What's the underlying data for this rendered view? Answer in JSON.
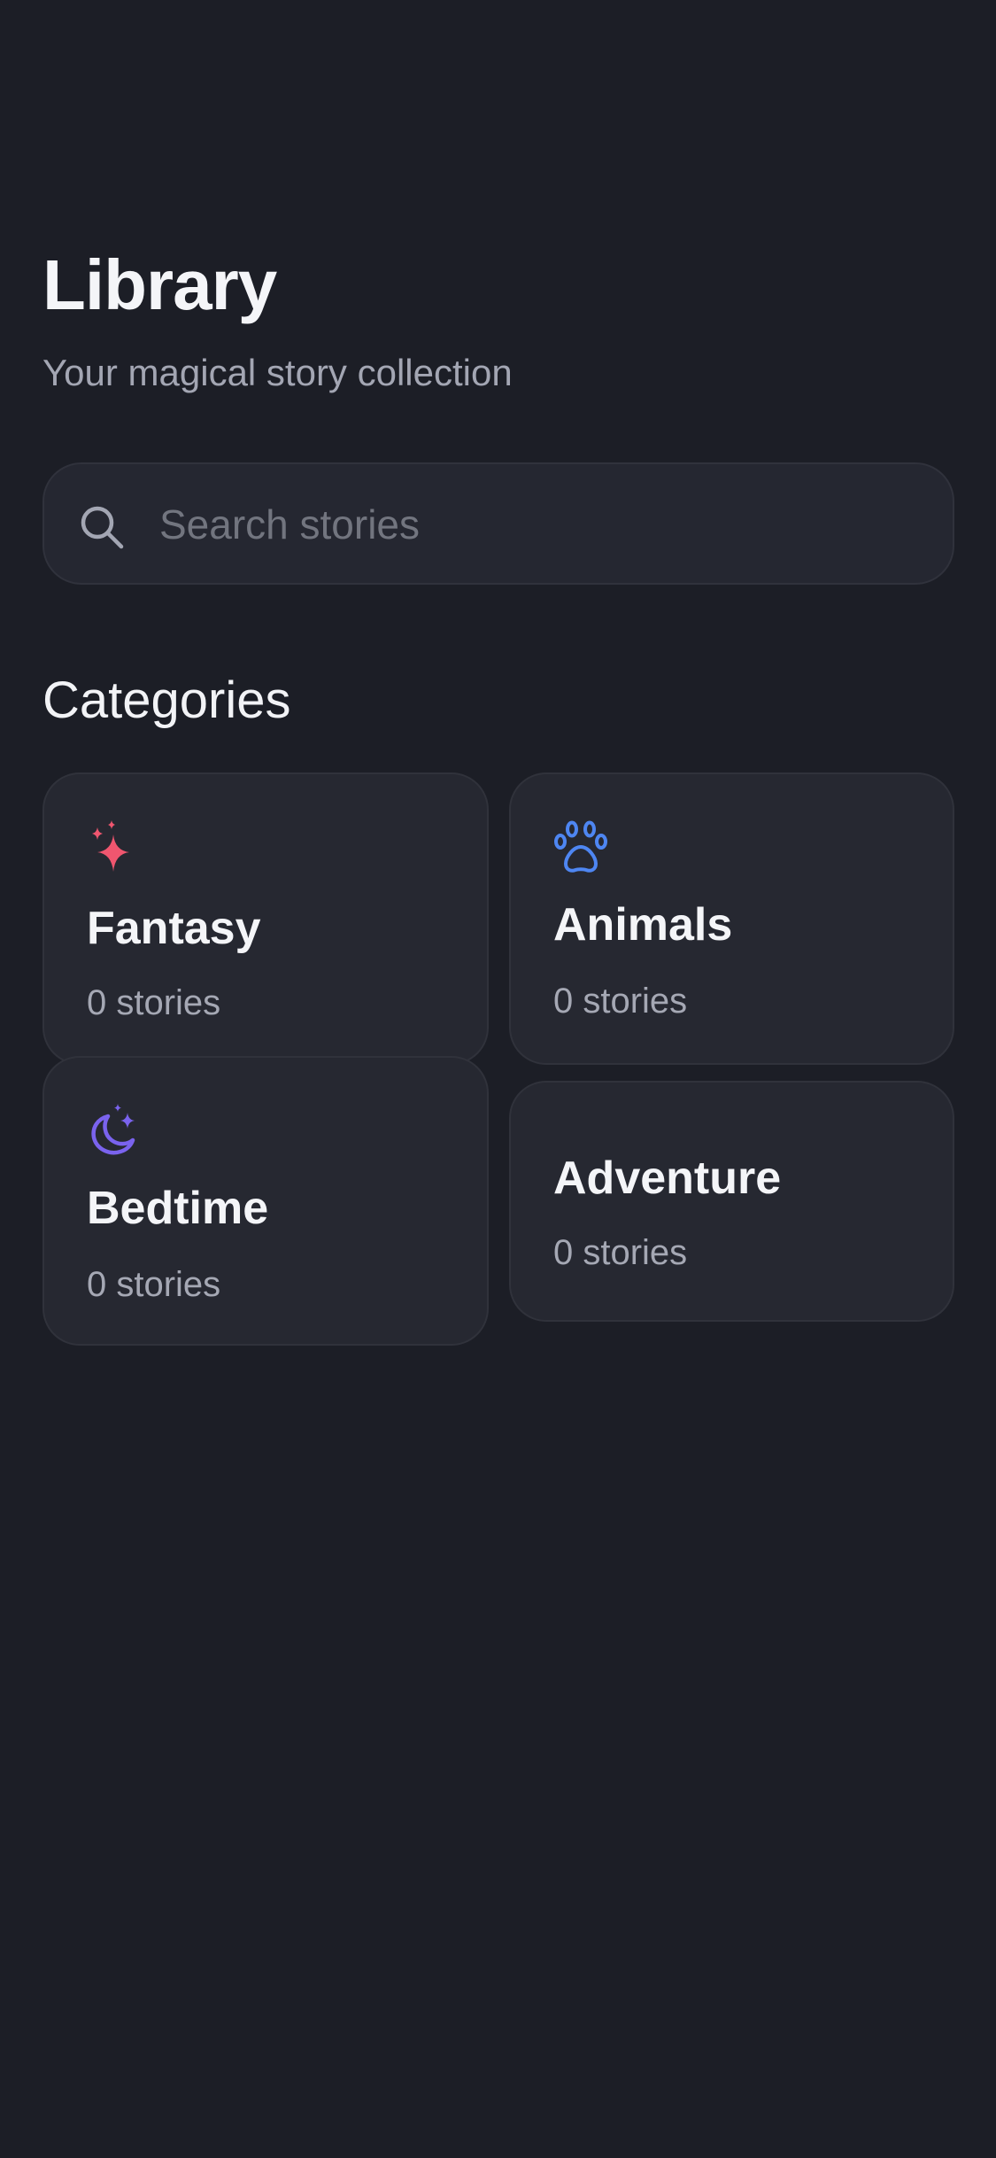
{
  "header": {
    "title": "Library",
    "subtitle": "Your magical story collection"
  },
  "search": {
    "placeholder": "Search stories",
    "value": "",
    "icon": "search-icon"
  },
  "categories": {
    "title": "Categories",
    "items": [
      {
        "name": "Fantasy",
        "count": "0 stories",
        "icon": "sparkles-icon",
        "color": "#f0566f"
      },
      {
        "name": "Animals",
        "count": "0 stories",
        "icon": "paw-icon",
        "color": "#4e86f2"
      },
      {
        "name": "Bedtime",
        "count": "0 stories",
        "icon": "moon-stars-icon",
        "color": "#7a63ee"
      },
      {
        "name": "Adventure",
        "count": "0 stories",
        "icon": "",
        "color": ""
      }
    ]
  },
  "colors": {
    "background": "#1c1e26",
    "card": "#262831",
    "text_primary": "#f4f5f8",
    "text_secondary": "#a5a8b4"
  }
}
